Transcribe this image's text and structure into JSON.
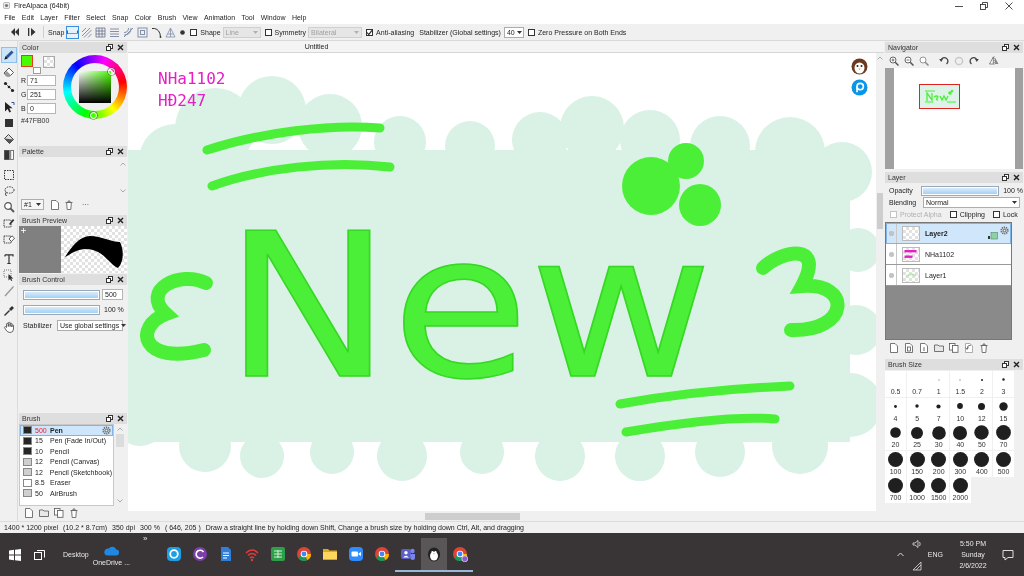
{
  "window": {
    "title": "FireAlpaca (64bit)"
  },
  "menu": [
    "File",
    "Edit",
    "Layer",
    "Filter",
    "Select",
    "Snap",
    "Color",
    "Brush",
    "View",
    "Animation",
    "Tool",
    "Window",
    "Help"
  ],
  "toolbar": {
    "snap_label": "Snap",
    "snap_modes": [
      {
        "selected": true
      },
      {
        "selected": false
      },
      {
        "selected": false
      },
      {
        "selected": false
      },
      {
        "selected": false
      },
      {
        "selected": false
      },
      {
        "selected": false
      },
      {
        "selected": false
      }
    ],
    "shape": {
      "checked": false,
      "label": "Shape",
      "value": "Line",
      "disabled": true
    },
    "symmetry": {
      "checked": false,
      "label": "Symmetry",
      "value": "Bilateral",
      "disabled": true
    },
    "anti_aliasing": {
      "checked": true,
      "label": "Anti-aliasing"
    },
    "stabilizer": {
      "label": "Stabilizer (Global settings)",
      "value": "40"
    },
    "zero_pressure": {
      "checked": false,
      "label": "Zero Pressure on Both Ends"
    }
  },
  "tools": [
    {
      "selected": true
    },
    {
      "selected": false
    },
    {
      "selected": false
    },
    {
      "selected": false
    },
    {
      "selected": false
    },
    {
      "selected": false
    },
    {
      "selected": false
    },
    {
      "selected": false
    },
    {
      "selected": false
    },
    {
      "selected": false
    },
    {
      "selected": false
    },
    {
      "selected": false
    },
    {
      "selected": false
    },
    {
      "selected": false
    },
    {
      "selected": false
    },
    {
      "selected": false
    },
    {
      "selected": false
    }
  ],
  "color_panel": {
    "title": "Color",
    "channels": [
      {
        "label": "R",
        "value": "71"
      },
      {
        "label": "G",
        "value": "251"
      },
      {
        "label": "B",
        "value": "0"
      }
    ],
    "hex": "#47FB00"
  },
  "palette_panel": {
    "title": "Palette",
    "palette": "#1",
    "more": "···"
  },
  "brush_preview_panel": {
    "title": "Brush Preview"
  },
  "brush_control_panel": {
    "title": "Brush Control",
    "size": {
      "level": 1,
      "value": "500"
    },
    "opacity": {
      "level": 1,
      "value": "100 %"
    },
    "stabilizer": {
      "label": "Stabilizer",
      "value": "Use global settings"
    }
  },
  "brush_panel": {
    "title": "Brush",
    "brushes": [
      {
        "size": "500",
        "name": "Pen",
        "color": "#262626",
        "selected": true
      },
      {
        "size": "15",
        "name": "Pen (Fade In/Out)",
        "color": "#262626",
        "selected": false
      },
      {
        "size": "10",
        "name": "Pencil",
        "color": "#262626",
        "selected": false
      },
      {
        "size": "12",
        "name": "Pencil (Canvas)",
        "color": "#cfcfcf",
        "selected": false
      },
      {
        "size": "12",
        "name": "Pencil (Sketchbook)",
        "color": "#cfcfcf",
        "selected": false
      },
      {
        "size": "8.5",
        "name": "Eraser",
        "color": "#ffffff",
        "selected": false
      },
      {
        "size": "50",
        "name": "AirBrush",
        "color": "#cfcfcf",
        "selected": false
      }
    ]
  },
  "canvas": {
    "tab": "Untitled",
    "text_lines": [
      "NHa1102",
      "HĐ247"
    ],
    "lettering": "New"
  },
  "navigator_panel": {
    "title": "Navigator"
  },
  "layer_panel": {
    "title": "Layer",
    "opacity": {
      "label": "Opacity",
      "level": 1,
      "value": "100 %"
    },
    "blending": {
      "label": "Blending",
      "value": "Normal"
    },
    "options": [
      {
        "label": "Protect Alpha",
        "checked": false,
        "disabled": true
      },
      {
        "label": "Clipping",
        "checked": false,
        "disabled": false
      },
      {
        "label": "Lock",
        "checked": false,
        "disabled": false
      }
    ],
    "layers": [
      {
        "name": "Layer2",
        "selected": true
      },
      {
        "name": "NHa1102",
        "selected": false
      },
      {
        "name": "Layer1",
        "selected": false
      }
    ]
  },
  "brush_size_panel": {
    "title": "Brush Size",
    "sizes": [
      "0.5",
      "0.7",
      "1",
      "1.5",
      "2",
      "3",
      "4",
      "5",
      "7",
      "10",
      "12",
      "15",
      "20",
      "25",
      "30",
      "40",
      "50",
      "70",
      "100",
      "150",
      "200",
      "300",
      "400",
      "500",
      "700",
      "1000",
      "1500",
      "2000"
    ]
  },
  "status_bar": [
    "1400 * 1200 pixel",
    "(10.2 * 8.7cm)",
    "350 dpi",
    "300 %",
    "( 646, 205 )",
    "Draw a straight line by holding down Shift, Change a brush size by holding down Ctrl, Alt, and dragging"
  ],
  "taskbar": {
    "desktop": "Desktop",
    "onedrive": "OneDrive ...",
    "overflow": "»",
    "apps": [
      {
        "selected": false,
        "running": false
      },
      {
        "selected": false,
        "running": false
      },
      {
        "selected": false,
        "running": false
      },
      {
        "selected": false,
        "running": false
      },
      {
        "selected": false,
        "running": false
      },
      {
        "selected": false,
        "running": false
      },
      {
        "selected": false,
        "running": false
      },
      {
        "selected": false,
        "running": false
      },
      {
        "selected": false,
        "running": false
      },
      {
        "selected": false,
        "running": true
      },
      {
        "selected": true,
        "running": true
      },
      {
        "selected": false,
        "running": true
      }
    ],
    "language": "ENG",
    "time": "5:50 PM",
    "day": "Sunday",
    "date": "2/6/2022"
  }
}
